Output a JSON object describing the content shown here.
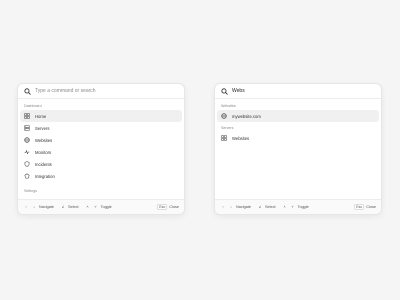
{
  "left_palette": {
    "search": {
      "value": "",
      "placeholder": "Type a command or search"
    },
    "sections": [
      {
        "label": "Dashboard",
        "items": [
          {
            "label": "Home",
            "icon": "grid-icon",
            "active": true
          },
          {
            "label": "Servers",
            "icon": "server-icon"
          },
          {
            "label": "Websites",
            "icon": "globe-icon"
          },
          {
            "label": "Monitors",
            "icon": "monitor-icon"
          },
          {
            "label": "Incidents",
            "icon": "shield-icon"
          },
          {
            "label": "Integration",
            "icon": "puzzle-icon"
          }
        ]
      },
      {
        "label": "Settings",
        "items": []
      }
    ]
  },
  "right_palette": {
    "search": {
      "value": "Webs",
      "placeholder": ""
    },
    "sections": [
      {
        "label": "Websites",
        "items": [
          {
            "label": "mywebsite.com",
            "icon": "globe-icon",
            "active": true
          }
        ]
      },
      {
        "label": "Servers",
        "items": [
          {
            "label": "Websites",
            "icon": "server-icon"
          }
        ]
      }
    ]
  },
  "footer": {
    "navigate_label": "Navigate",
    "select_label": "Select",
    "toggle_label": "Toggle",
    "close_label": "Close",
    "up_key": "↑",
    "down_key": "↓",
    "enter_key": "↲",
    "toggle_keys": [
      "˄",
      "˅"
    ],
    "esc_key": "Esc"
  }
}
